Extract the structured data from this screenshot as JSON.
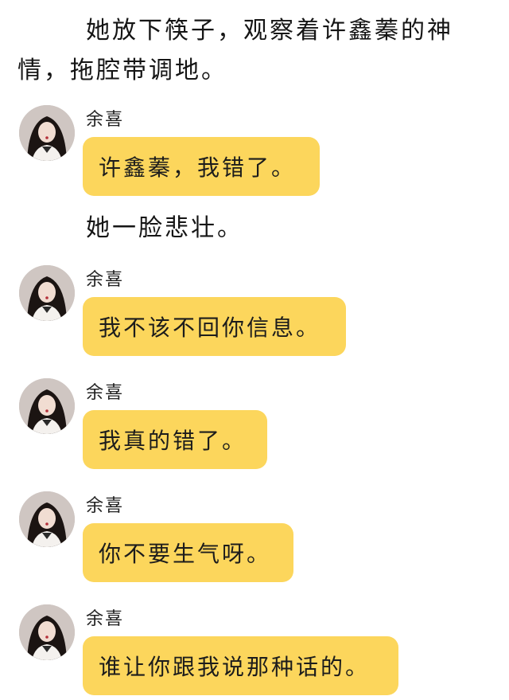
{
  "narration": {
    "line1": "她放下筷子，观察着许鑫蓁的神",
    "line2": "情，拖腔带调地。",
    "line3": "她一脸悲壮。"
  },
  "messages": [
    {
      "sender": "余喜",
      "text": "许鑫蓁，我错了。",
      "avatar_icon": "profile-photo"
    },
    {
      "sender": "余喜",
      "text": "我不该不回你信息。",
      "avatar_icon": "profile-photo"
    },
    {
      "sender": "余喜",
      "text": "我真的错了。",
      "avatar_icon": "profile-photo"
    },
    {
      "sender": "余喜",
      "text": "你不要生气呀。",
      "avatar_icon": "profile-photo"
    },
    {
      "sender": "余喜",
      "text": "谁让你跟我说那种话的。",
      "avatar_icon": "profile-photo"
    }
  ],
  "colors": {
    "bubble": "#fcd65c",
    "background": "#ffffff",
    "text": "#1a1a1a"
  }
}
